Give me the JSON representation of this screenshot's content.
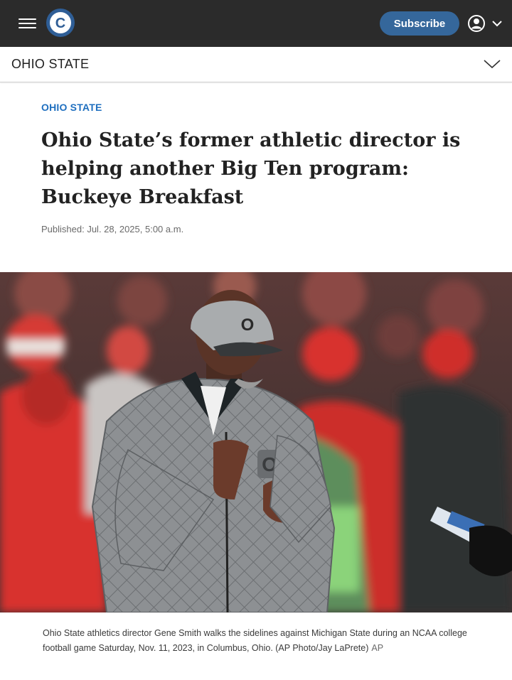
{
  "header": {
    "menu_icon": "hamburger-menu-icon",
    "logo_icon": "cleveland-c-logo-icon",
    "logo_letter": "C",
    "subscribe_label": "Subscribe",
    "account_icon": "user-account-icon",
    "brand_color": "#2f5e96"
  },
  "section": {
    "title": "OHIO STATE",
    "toggle_icon": "chevron-down-icon"
  },
  "article": {
    "kicker": "OHIO STATE",
    "headline": "Ohio State’s former athletic director is helping another Big Ten program: Buckeye Breakfast",
    "published": "Published: Jul. 28, 2025, 5:00 a.m."
  },
  "photo": {
    "caption": "Ohio State athletics director Gene Smith walks the sidelines against Michigan State during an NCAA college football game Saturday, Nov. 11, 2023, in Columbus, Ohio. (AP Photo/Jay LaPrete)",
    "credit": "AP"
  }
}
